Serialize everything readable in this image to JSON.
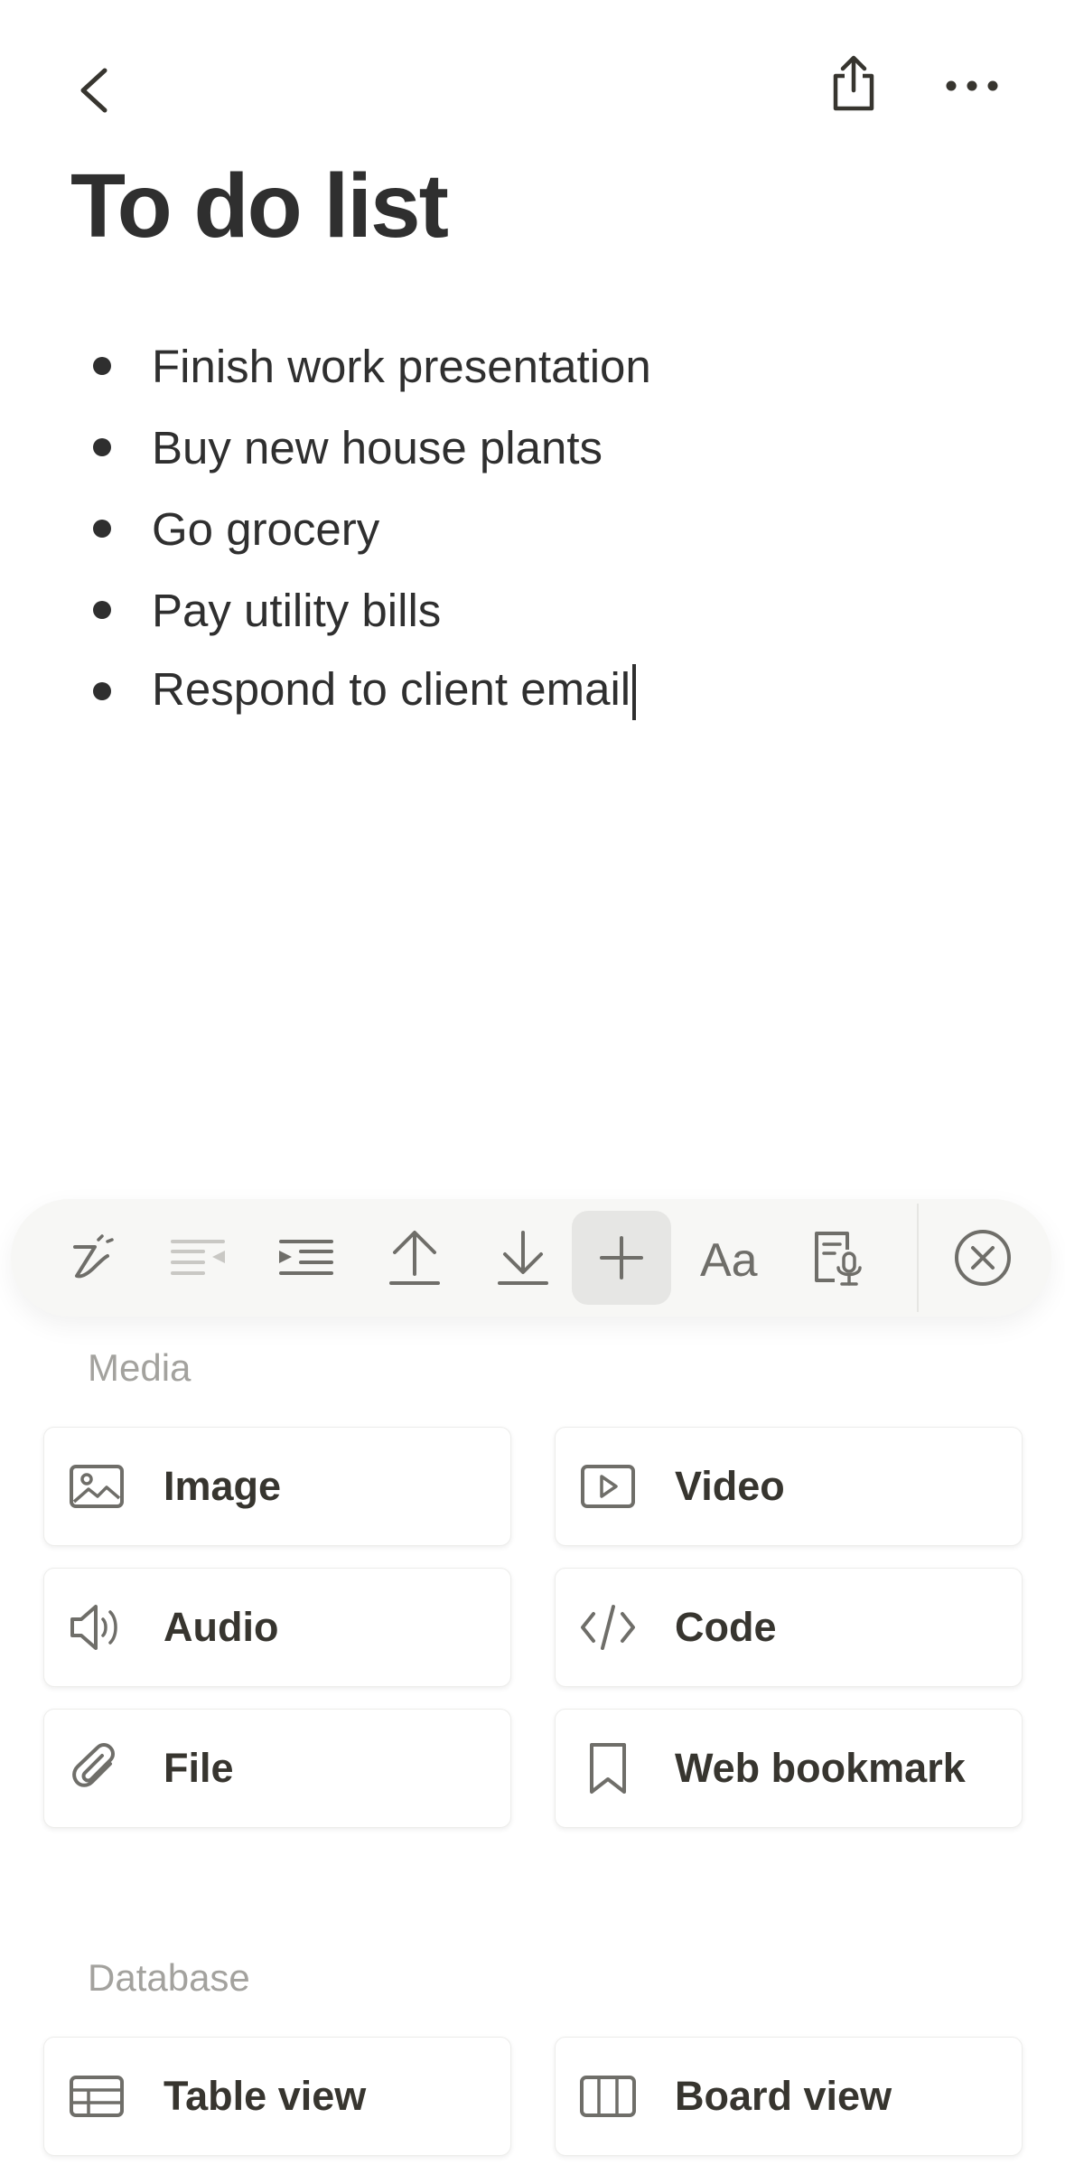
{
  "page": {
    "title": "To do list"
  },
  "todos": [
    "Finish work presentation",
    "Buy new house plants",
    "Go grocery",
    "Pay utility bills",
    "Respond to client email"
  ],
  "toolbar": {
    "tools": [
      "ai-pen-icon",
      "outdent-icon",
      "indent-icon",
      "move-up-icon",
      "move-down-icon",
      "add-block-icon",
      "text-style-icon",
      "dictation-icon",
      "close-icon"
    ],
    "active_tool": "add-block-icon"
  },
  "media": {
    "title": "Media",
    "items": [
      "Image",
      "Video",
      "Audio",
      "Code",
      "File",
      "Web bookmark"
    ]
  },
  "database": {
    "title": "Database",
    "items": [
      "Table view",
      "Board view"
    ]
  },
  "colors": {
    "text": "#37352f",
    "muted": "#a3a29e",
    "toolbar_bg": "#f7f7f5"
  }
}
